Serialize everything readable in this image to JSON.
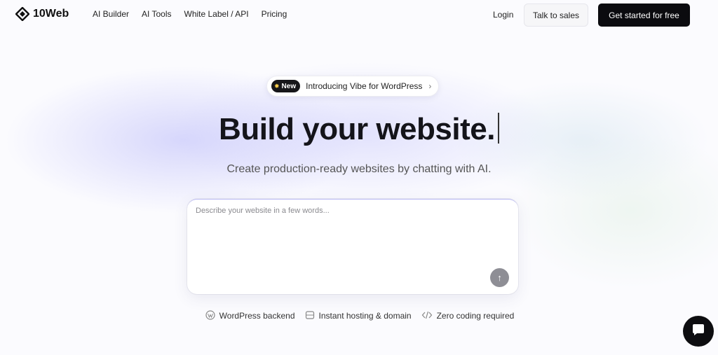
{
  "brand": {
    "name": "10Web"
  },
  "nav": {
    "items": [
      "AI Builder",
      "AI Tools",
      "White Label / API",
      "Pricing"
    ],
    "login": "Login",
    "talk_to_sales": "Talk to sales",
    "get_started": "Get started for free"
  },
  "announcement": {
    "badge": "New",
    "text": "Introducing Vibe for WordPress",
    "icon": "star-icon"
  },
  "hero": {
    "title": "Build your website.",
    "subtitle": "Create production-ready websites by chatting with AI."
  },
  "prompt": {
    "placeholder": "Describe your website in a few words...",
    "value": ""
  },
  "features": [
    {
      "icon": "wordpress-icon",
      "label": "WordPress backend"
    },
    {
      "icon": "server-icon",
      "label": "Instant hosting & domain"
    },
    {
      "icon": "code-icon",
      "label": "Zero coding required"
    }
  ],
  "colors": {
    "primary_button": "#0b0b0f",
    "accent_glow": "#c9c9fb",
    "send_button": "#8e8e95"
  }
}
